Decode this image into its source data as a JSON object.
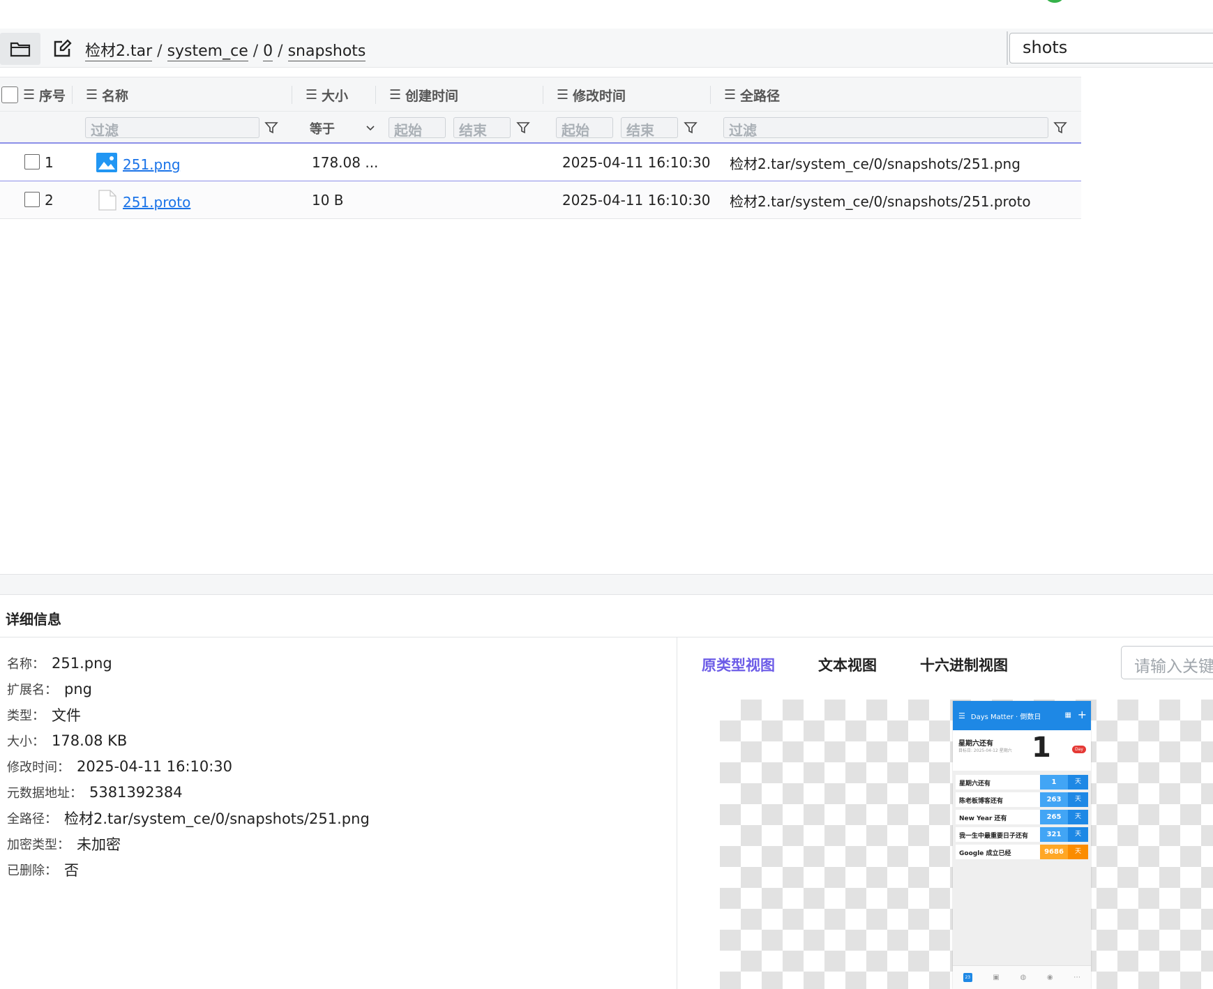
{
  "breadcrumb": [
    "检材2.tar",
    "system_ce",
    "0",
    "snapshots"
  ],
  "breadcrumb_separator": "/",
  "search": {
    "value": "shots"
  },
  "table": {
    "columns": {
      "index": "序号",
      "name": "名称",
      "size": "大小",
      "created": "创建时间",
      "modified": "修改时间",
      "fullpath": "全路径"
    },
    "filters": {
      "name_placeholder": "过滤",
      "size_op": "等于",
      "created_start": "起始",
      "created_end": "结束",
      "modified_start": "起始",
      "modified_end": "结束",
      "path_placeholder": "过滤"
    },
    "rows": [
      {
        "index": "1",
        "name": "251.png",
        "size": "178.08 ...",
        "created": "",
        "modified": "2025-04-11 16:10:30",
        "path": "检材2.tar/system_ce/0/snapshots/251.png",
        "icon": "image-file-icon"
      },
      {
        "index": "2",
        "name": "251.proto",
        "size": "10 B",
        "created": "",
        "modified": "2025-04-11 16:10:30",
        "path": "检材2.tar/system_ce/0/snapshots/251.proto",
        "icon": "blank-file-icon"
      }
    ]
  },
  "details": {
    "title": "详细信息",
    "colon": "：",
    "props": [
      {
        "key": "名称",
        "value": "251.png"
      },
      {
        "key": "扩展名",
        "value": "png"
      },
      {
        "key": "类型",
        "value": "文件"
      },
      {
        "key": "大小",
        "value": "178.08 KB"
      },
      {
        "key": "修改时间",
        "value": "2025-04-11 16:10:30"
      },
      {
        "key": "元数据地址",
        "value": "5381392384"
      },
      {
        "key": "全路径",
        "value": "检材2.tar/system_ce/0/snapshots/251.png"
      },
      {
        "key": "加密类型",
        "value": "未加密"
      },
      {
        "key": "已删除",
        "value": "否"
      }
    ],
    "tabs": [
      "原类型视图",
      "文本视图",
      "十六进制视图"
    ],
    "active_tab": 0,
    "keyword_placeholder": "请输入关键"
  },
  "preview": {
    "app_title": "Days Matter · 倒数日",
    "hero_title": "星期六还有",
    "hero_subtitle": "目标日: 2025-04-12 星期六",
    "hero_number": "1",
    "hero_badge": "Day",
    "items": [
      {
        "label": "星期六还有",
        "num": "1",
        "unit": "天",
        "accent": "blue"
      },
      {
        "label": "陈老板博客还有",
        "num": "263",
        "unit": "天",
        "accent": "blue"
      },
      {
        "label": "New Year 还有",
        "num": "265",
        "unit": "天",
        "accent": "blue"
      },
      {
        "label": "我一生中最重要日子还有",
        "num": "321",
        "unit": "天",
        "accent": "blue"
      },
      {
        "label": "Google 成立已经",
        "num": "9686",
        "unit": "天",
        "accent": "orange"
      }
    ],
    "nav_calendar": "23"
  },
  "colors": {
    "accent": "#6c5ce7",
    "link": "#1a73e8",
    "select_line": "#8b8fe8",
    "phone_blue": "#1e88e5",
    "phone_orange": "#fb8c00"
  }
}
